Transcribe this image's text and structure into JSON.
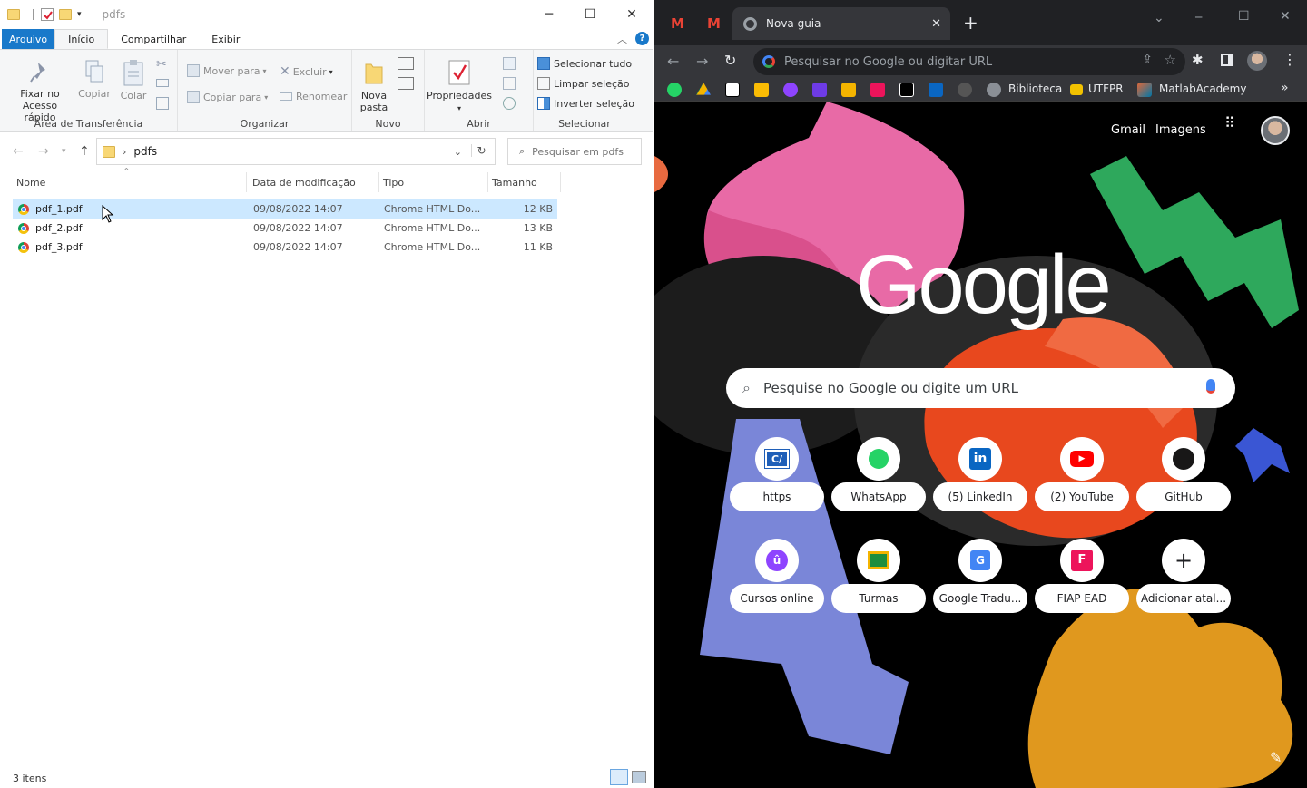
{
  "explorer": {
    "title": "pdfs",
    "tabs": {
      "file": "Arquivo",
      "home": "Início",
      "share": "Compartilhar",
      "view": "Exibir"
    },
    "ribbon": {
      "pin_line1": "Fixar no",
      "pin_line2": "Acesso rápido",
      "copy": "Copiar",
      "paste": "Colar",
      "clipboard_group": "Área de Transferência",
      "move_to": "Mover para",
      "copy_to": "Copiar para",
      "delete": "Excluir",
      "rename": "Renomear",
      "organize_group": "Organizar",
      "new_folder_line1": "Nova",
      "new_folder_line2": "pasta",
      "new_group": "Novo",
      "properties": "Propriedades",
      "open_group": "Abrir",
      "select_all": "Selecionar tudo",
      "select_none": "Limpar seleção",
      "invert_selection": "Inverter seleção",
      "select_group": "Selecionar"
    },
    "address": {
      "path": "pdfs",
      "search_placeholder": "Pesquisar em pdfs"
    },
    "columns": {
      "name": "Nome",
      "modified": "Data de modificação",
      "type": "Tipo",
      "size": "Tamanho"
    },
    "files": [
      {
        "name": "pdf_1.pdf",
        "modified": "09/08/2022 14:07",
        "type": "Chrome HTML Do...",
        "size": "12 KB"
      },
      {
        "name": "pdf_2.pdf",
        "modified": "09/08/2022 14:07",
        "type": "Chrome HTML Do...",
        "size": "13 KB"
      },
      {
        "name": "pdf_3.pdf",
        "modified": "09/08/2022 14:07",
        "type": "Chrome HTML Do...",
        "size": "11 KB"
      }
    ],
    "status": "3 itens"
  },
  "chrome": {
    "tab_title": "Nova guia",
    "omnibox_placeholder": "Pesquisar no Google ou digitar URL",
    "bookmarks": {
      "biblioteca": "Biblioteca",
      "utfpr": "UTFPR",
      "matlab": "MatlabAcademy"
    },
    "ntp": {
      "gmail": "Gmail",
      "images": "Imagens",
      "logo": "Google",
      "search_placeholder": "Pesquise no Google ou digite um URL",
      "shortcuts": [
        {
          "label": "https",
          "icon": "https-site-icon"
        },
        {
          "label": "WhatsApp",
          "icon": "whatsapp-icon"
        },
        {
          "label": "(5) LinkedIn",
          "icon": "linkedin-icon"
        },
        {
          "label": "(2) YouTube",
          "icon": "youtube-icon"
        },
        {
          "label": "GitHub",
          "icon": "github-icon"
        },
        {
          "label": "Cursos online",
          "icon": "cursos-online-icon"
        },
        {
          "label": "Turmas",
          "icon": "google-classroom-icon"
        },
        {
          "label": "Google Tradu...",
          "icon": "google-translate-icon"
        },
        {
          "label": "FIAP EAD",
          "icon": "fiap-icon"
        },
        {
          "label": "Adicionar atal...",
          "icon": "plus-icon"
        }
      ]
    }
  }
}
